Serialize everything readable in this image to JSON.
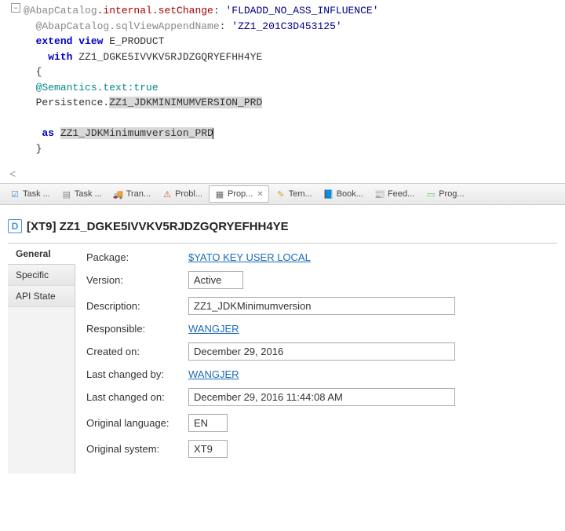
{
  "code": {
    "line1a": "@AbapCatalog",
    "line1b": ".internal.setChange",
    "line1c": ": ",
    "line1d": "'FLDADD_NO_ASS_INFLUENCE'",
    "line2a": "@AbapCatalog.sqlViewAppendName",
    "line2b": ": ",
    "line2c": "'ZZ1_201C3D453125'",
    "line3a": "extend view",
    "line3b": " E_PRODUCT",
    "line4a": "  with",
    "line4b": " ZZ1_DGKE5IVVKV5RJDZGQRYEFHH4YE",
    "line5": "{",
    "line6": "@Semantics.text:true",
    "line7a": "Persistence.",
    "line7b": "ZZ1_JDKMINIMUMVERSION_PRD",
    "line8a": " as",
    "line8b": " ",
    "line8c": "ZZ1_JDKMinimumversion_PRD",
    "line9": "}"
  },
  "tabs": {
    "task1": "Task ...",
    "task2": "Task ...",
    "tran": "Tran...",
    "probl": "Probl...",
    "prop": "Prop...",
    "tem": "Tem...",
    "book": "Book...",
    "feed": "Feed...",
    "prog": "Prog..."
  },
  "props": {
    "title_prefix": "[XT9] ",
    "title": "ZZ1_DGKE5IVVKV5RJDZGQRYEFHH4YE",
    "sidetabs": {
      "general": "General",
      "specific": "Specific",
      "apistate": "API State"
    },
    "labels": {
      "package": "Package:",
      "version": "Version:",
      "description": "Description:",
      "responsible": "Responsible:",
      "createdon": "Created on:",
      "lastchangedby": "Last changed by:",
      "lastchangedon": "Last changed on:",
      "origlang": "Original language:",
      "origsys": "Original system:"
    },
    "values": {
      "package": "$YATO KEY USER LOCAL",
      "version": "Active",
      "description": "ZZ1_JDKMinimumversion",
      "responsible": "WANGJER",
      "createdon": "December 29, 2016",
      "lastchangedby": "WANGJER",
      "lastchangedon": "December 29, 2016 11:44:08 AM",
      "origlang": "EN",
      "origsys": "XT9"
    }
  }
}
